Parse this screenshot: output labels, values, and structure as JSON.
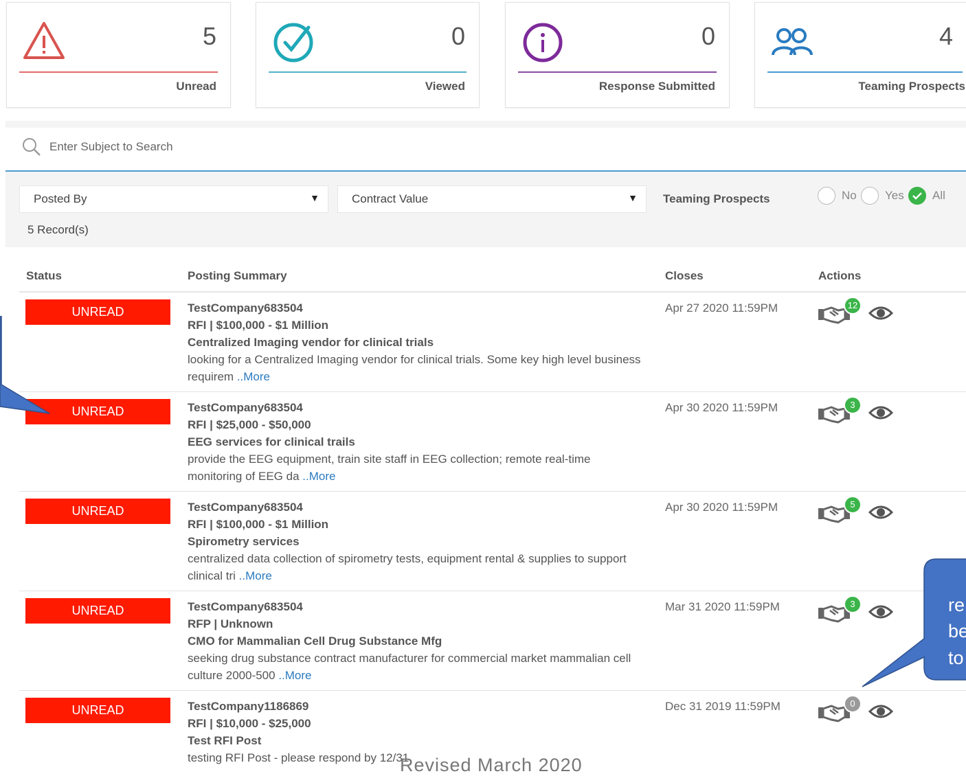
{
  "cards": [
    {
      "count": "5",
      "label": "Unread",
      "icon": "warning-triangle-icon",
      "color": "#d9534f"
    },
    {
      "count": "0",
      "label": "Viewed",
      "icon": "check-circle-icon",
      "color": "#1fa8b8"
    },
    {
      "count": "0",
      "label": "Response Submitted",
      "icon": "info-circle-icon",
      "color": "#7d2a9a"
    },
    {
      "count": "4",
      "label": "Teaming Prospects",
      "icon": "users-icon",
      "color": "#2a7bc0"
    }
  ],
  "search": {
    "placeholder": "Enter Subject to Search"
  },
  "filters": {
    "posted_by": "Posted By",
    "contract_value": "Contract Value",
    "teaming_label": "Teaming Prospects",
    "radios": [
      "No",
      "Yes",
      "All"
    ],
    "selected": "All"
  },
  "record_count": "5 Record(s)",
  "columns": [
    "Status",
    "Posting Summary",
    "Closes",
    "Actions"
  ],
  "rows": [
    {
      "status": "UNREAD",
      "company": "TestCompany683504",
      "type_value": "RFI | $100,000 - $1 Million",
      "subject": "Centralized Imaging vendor for clinical trials",
      "desc1": "looking for a Centralized Imaging vendor for clinical trials. Some key high level business",
      "desc2": "requirem",
      "more": "..More",
      "closes": "Apr 27 2020 11:59PM",
      "count": "12"
    },
    {
      "status": "UNREAD",
      "company": "TestCompany683504",
      "type_value": "RFI | $25,000 - $50,000",
      "subject": "EEG services for clinical trails",
      "desc1": "provide the EEG equipment, train site staff in EEG collection; remote real-time",
      "desc2": "monitoring of EEG da",
      "more": "..More",
      "closes": "Apr 30 2020 11:59PM",
      "count": "3"
    },
    {
      "status": "UNREAD",
      "company": "TestCompany683504",
      "type_value": "RFI | $100,000 - $1 Million",
      "subject": "Spirometry services",
      "desc1": "centralized data collection of spirometry tests, equipment rental & supplies to support",
      "desc2": "clinical tri",
      "more": "..More",
      "closes": "Apr 30 2020 11:59PM",
      "count": "5"
    },
    {
      "status": "UNREAD",
      "company": "TestCompany683504",
      "type_value": "RFP | Unknown",
      "subject": "CMO for Mammalian Cell Drug Substance Mfg",
      "desc1": "seeking drug substance contract manufacturer for commercial market mammalian cell",
      "desc2": "culture 2000-500",
      "more": "..More",
      "closes": "Mar 31 2020 11:59PM",
      "count": "3"
    },
    {
      "status": "UNREAD",
      "company": "TestCompany1186869",
      "type_value": "RFI | $10,000 - $25,000",
      "subject": "Test RFI Post",
      "desc1": "testing RFI Post - please respond by 12/31",
      "desc2": "",
      "more": "",
      "closes": "Dec 31 2019 11:59PM",
      "count": "0"
    }
  ],
  "callout_text": [
    "re",
    "be",
    "to"
  ],
  "footer_fragment": "Revised March 2020",
  "colors": {
    "accent": "#2a7bc0",
    "unread": "#ff1a00",
    "callout": "#4472c4",
    "badge_green": "#3bb54a"
  }
}
